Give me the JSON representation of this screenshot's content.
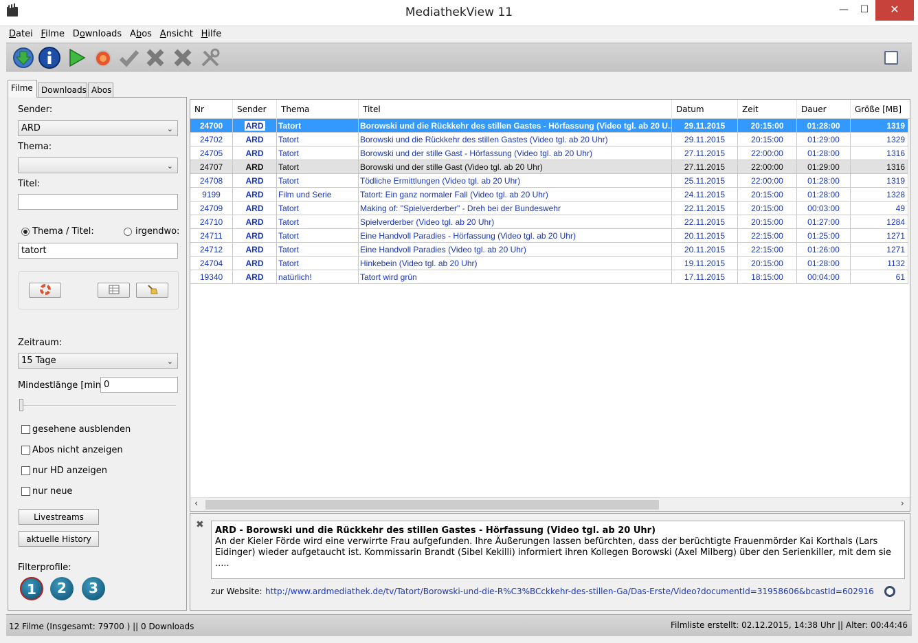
{
  "window": {
    "title": "MediathekView 11"
  },
  "menu": [
    {
      "label": "Datei",
      "mnemonic": "D",
      "rest": "atei"
    },
    {
      "label": "Filme",
      "mnemonic": "F",
      "rest": "ilme"
    },
    {
      "label": "Downloads",
      "mnemonic": "o",
      "pre": "D",
      "rest": "wnloads"
    },
    {
      "label": "Abos",
      "mnemonic": "b",
      "pre": "A",
      "rest": "os"
    },
    {
      "label": "Ansicht",
      "mnemonic": "A",
      "rest": "nsicht"
    },
    {
      "label": "Hilfe",
      "mnemonic": "H",
      "rest": "ilfe"
    }
  ],
  "toolbar": {
    "icons": [
      "download-list-icon",
      "info-icon",
      "play-icon",
      "record-icon",
      "checkmark-icon",
      "delete-icon",
      "delete-all-icon",
      "settings-tools-icon"
    ],
    "fullscreen_icon": "fullscreen-icon"
  },
  "tabs": [
    "Filme",
    "Downloads",
    "Abos"
  ],
  "filter": {
    "sender_label": "Sender:",
    "sender_value": "ARD",
    "thema_label": "Thema:",
    "thema_value": "",
    "titel_label": "Titel:",
    "titel_value": "",
    "radio_thema_titel": "Thema / Titel:",
    "radio_irgendwo": "irgendwo:",
    "search_value": "tatort",
    "zeitraum_label": "Zeitraum:",
    "zeitraum_value": "15 Tage",
    "mindest_label": "Mindestlänge [min]:",
    "mindest_value": "0",
    "checkboxes": [
      "gesehene ausblenden",
      "Abos nicht anzeigen",
      "nur HD anzeigen",
      "nur neue"
    ],
    "livestreams": "Livestreams",
    "history": "aktuelle History",
    "profiles_label": "Filterprofile:",
    "profiles": [
      "1",
      "2",
      "3"
    ]
  },
  "table": {
    "columns": [
      "Nr",
      "Sender",
      "Thema",
      "Titel",
      "Datum",
      "Zeit",
      "Dauer",
      "Größe [MB]"
    ],
    "rows": [
      [
        "24700",
        "ARD",
        "Tatort",
        "Borowski und die Rückkehr des stillen Gastes - Hörfassung (Video tgl. ab 20 U...",
        "29.11.2015",
        "20:15:00",
        "01:28:00",
        "1319"
      ],
      [
        "24702",
        "ARD",
        "Tatort",
        "Borowski und die Rückkehr des stillen Gastes (Video tgl. ab 20 Uhr)",
        "29.11.2015",
        "20:15:00",
        "01:29:00",
        "1329"
      ],
      [
        "24705",
        "ARD",
        "Tatort",
        "Borowski und der stille Gast - Hörfassung (Video tgl. ab 20 Uhr)",
        "27.11.2015",
        "22:00:00",
        "01:28:00",
        "1316"
      ],
      [
        "24707",
        "ARD",
        "Tatort",
        "Borowski und der stille Gast (Video tgl. ab 20 Uhr)",
        "27.11.2015",
        "22:00:00",
        "01:29:00",
        "1316"
      ],
      [
        "24708",
        "ARD",
        "Tatort",
        "Tödliche Ermittlungen (Video tgl. ab 20 Uhr)",
        "25.11.2015",
        "22:00:00",
        "01:28:00",
        "1319"
      ],
      [
        "9199",
        "ARD",
        "Film und Serie",
        "Tatort: Ein ganz normaler Fall (Video tgl. ab 20 Uhr)",
        "24.11.2015",
        "20:15:00",
        "01:28:00",
        "1328"
      ],
      [
        "24709",
        "ARD",
        "Tatort",
        "Making of: \"Spielverderber\" - Dreh bei der Bundeswehr",
        "22.11.2015",
        "20:15:00",
        "00:03:00",
        "49"
      ],
      [
        "24710",
        "ARD",
        "Tatort",
        "Spielverderber (Video tgl. ab 20 Uhr)",
        "22.11.2015",
        "20:15:00",
        "01:27:00",
        "1284"
      ],
      [
        "24711",
        "ARD",
        "Tatort",
        "Eine Handvoll Paradies - Hörfassung (Video tgl. ab 20 Uhr)",
        "20.11.2015",
        "22:15:00",
        "01:25:00",
        "1271"
      ],
      [
        "24712",
        "ARD",
        "Tatort",
        "Eine Handvoll Paradies (Video tgl. ab 20 Uhr)",
        "20.11.2015",
        "22:15:00",
        "01:26:00",
        "1271"
      ],
      [
        "24704",
        "ARD",
        "Tatort",
        "Hinkebein (Video tgl. ab 20 Uhr)",
        "19.11.2015",
        "20:15:00",
        "01:28:00",
        "1132"
      ],
      [
        "19340",
        "ARD",
        "natürlich!",
        "Tatort wird grün",
        "17.11.2015",
        "18:15:00",
        "00:04:00",
        "61"
      ]
    ]
  },
  "description": {
    "title": "ARD  -  Borowski und die Rückkehr des stillen Gastes - Hörfassung (Video tgl. ab 20 Uhr)",
    "text": "An der Kieler Förde wird eine verwirrte Frau aufgefunden. Ihre Äußerungen lassen befürchten, dass der berüchtigte Frauenmörder Kai Korthals (Lars Eidinger) wieder aufgetaucht ist. Kommissarin Brandt (Sibel Kekilli) informiert ihren Kollegen Borowski (Axel Milberg) über den Serienkiller, mit dem sie .....",
    "website_label": "zur Website:",
    "website_url": "http://www.ardmediathek.de/tv/Tatort/Borowski-und-die-R%C3%BCckkehr-des-stillen-Ga/Das-Erste/Video?documentId=31958606&bcastId=602916"
  },
  "status": {
    "left": "12 Filme (Insgesamt: 79700 )  ||  0 Downloads",
    "right": "Filmliste erstellt: 02.12.2015, 14:38 Uhr  ||  Alter: 00:44:46"
  }
}
